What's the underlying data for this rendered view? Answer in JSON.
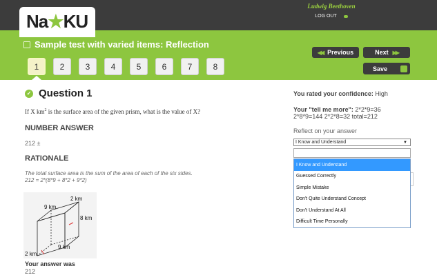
{
  "header": {
    "logo_left": "Na",
    "logo_right": "KU",
    "user_name": "Ludwig Beethoven",
    "logout_label": "LOG OUT"
  },
  "test": {
    "title": "Sample test with varied items: Reflection",
    "question_numbers": [
      "1",
      "2",
      "3",
      "4",
      "5",
      "6",
      "7",
      "8"
    ],
    "active_question": "1"
  },
  "nav": {
    "previous_label": "Previous",
    "next_label": "Next",
    "save_label": "Save"
  },
  "question": {
    "title": "Question 1",
    "prompt_before": "If X km",
    "prompt_sup": "2",
    "prompt_after": " is the surface area of the given prism, what is the value of X?",
    "number_answer_heading": "NUMBER ANSWER",
    "number_answer_value": "212 ±",
    "rationale_heading": "RATIONALE",
    "rationale_line1": "The total surface area is the sum of the area of each of the six sides.",
    "rationale_line2": "212 = 2*(8*9 + 8*2 + 9*2)",
    "figure_labels": [
      "9 km",
      "2 km",
      "8 km",
      "9 km",
      "2 km"
    ],
    "your_answer_label": "Your answer was",
    "your_answer_value": "212"
  },
  "reflection": {
    "confidence_prefix": "You rated your confidence:",
    "confidence_value": "High",
    "tell_label": "Your \"tell me more\":",
    "tell_line1": "2*2*9=36",
    "tell_line2": "2*8*9=144 2*2*8=32 total=212",
    "reflect_label": "Reflect on your answer",
    "selected_value": "I Know and Understand",
    "options": [
      "I Know and Understand",
      "Guessed Correctly",
      "Simple Mistake",
      "Don't Quite Understand Concept",
      "Don't Understand At All",
      "Difficult Time Personally"
    ]
  },
  "colors": {
    "accent_green": "#8dc63f",
    "dark_bar": "#3c3c3c",
    "dropdown_highlight": "#3399ff"
  }
}
